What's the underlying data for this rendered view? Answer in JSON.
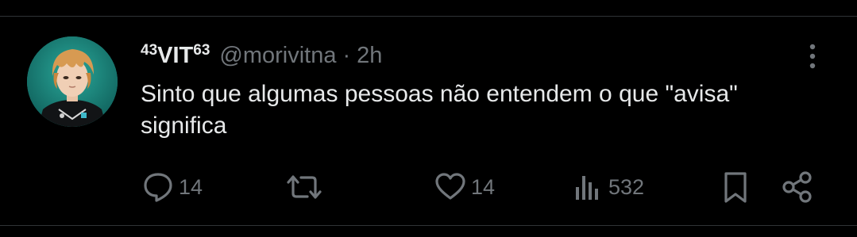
{
  "tweet": {
    "author": {
      "name_prefix_sup": "43",
      "name_main": "VIT",
      "name_suffix_sup": "63",
      "handle": "@morivitna",
      "separator": "·",
      "time": "2h"
    },
    "text": "Sinto que algumas pessoas não entendem o que \"avisa\" significa",
    "stats": {
      "replies": "14",
      "likes": "14",
      "views": "532"
    }
  },
  "colors": {
    "background": "#000000",
    "text": "#e7e9ea",
    "secondary": "#71767b",
    "divider": "#2f3336",
    "avatar_bg": "#1e8f86"
  },
  "icons": {
    "more": "more-vertical-icon",
    "reply": "reply-bubble-icon",
    "retweet": "retweet-icon",
    "like": "heart-icon",
    "views": "bar-chart-icon",
    "bookmark": "bookmark-icon",
    "share": "share-icon"
  }
}
